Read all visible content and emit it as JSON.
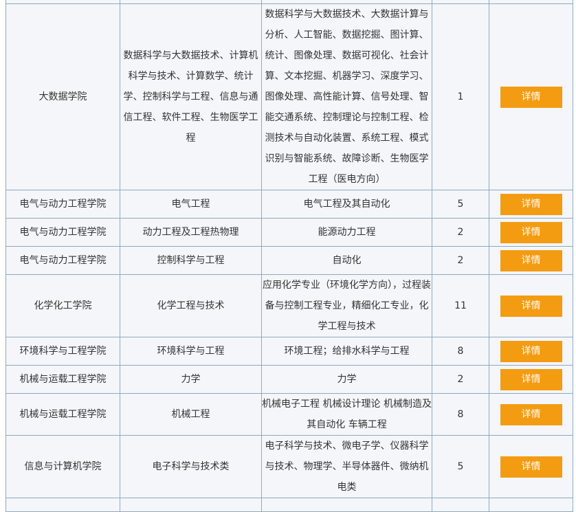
{
  "table": {
    "detail_label": "详情",
    "rows": [
      {
        "college": "大数据学院",
        "discipline": "数据科学与大数据技术、计算机科学与技术、计算数学、统计学、控制科学与工程、信息与通信工程、软件工程、生物医学工程",
        "specialty": "数据科学与大数据技术、大数据计算与分析、人工智能、数据挖掘、图计算、统计、图像处理、数据可视化、社会计算、文本挖掘、机器学习、深度学习、图像处理、高性能计算、信号处理、智能交通系统、控制理论与控制工程、检测技术与自动化装置、系统工程、模式识别与智能系统、故障诊断、生物医学工程（医电方向）",
        "count": "1"
      },
      {
        "college": "电气与动力工程学院",
        "discipline": "电气工程",
        "specialty": "电气工程及其自动化",
        "count": "5"
      },
      {
        "college": "电气与动力工程学院",
        "discipline": "动力工程及工程热物理",
        "specialty": "能源动力工程",
        "count": "2"
      },
      {
        "college": "电气与动力工程学院",
        "discipline": "控制科学与工程",
        "specialty": "自动化",
        "count": "2"
      },
      {
        "college": "化学化工学院",
        "discipline": "化学工程与技术",
        "specialty": "应用化学专业（环境化学方向），过程装备与控制工程专业，精细化工专业，化学工程与技术",
        "count": "11"
      },
      {
        "college": "环境科学与工程学院",
        "discipline": "环境科学与工程",
        "specialty": "环境工程；给排水科学与工程",
        "count": "8"
      },
      {
        "college": "机械与运载工程学院",
        "discipline": "力学",
        "specialty": "力学",
        "count": "2"
      },
      {
        "college": "机械与运载工程学院",
        "discipline": "机械工程",
        "specialty": "机械电子工程 机械设计理论 机械制造及其自动化 车辆工程",
        "count": "8"
      },
      {
        "college": "信息与计算机学院",
        "discipline": "电子科学与技术类",
        "specialty": "电子科学与技术、微电子学、仪器科学与技术、物理学、半导体器件、微纳机电类",
        "count": "5"
      }
    ]
  }
}
